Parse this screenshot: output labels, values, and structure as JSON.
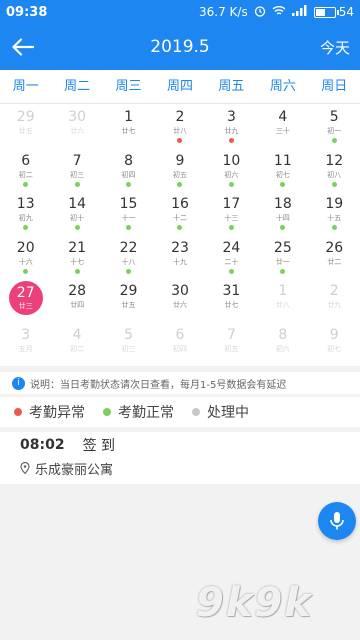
{
  "status_bar": {
    "time": "09:38",
    "speed": "36.7 K/s",
    "battery": "54",
    "battery_level": 0.54,
    "icons": [
      "alarm-icon",
      "wifi-icon",
      "signal-icon",
      "battery-icon"
    ]
  },
  "header": {
    "title": "2019.5",
    "today_label": "今天",
    "back_icon": "back-arrow-icon"
  },
  "weekdays": [
    "周一",
    "周二",
    "周三",
    "周四",
    "周五",
    "周六",
    "周日"
  ],
  "calendar": {
    "weeks": [
      [
        {
          "day": "29",
          "lunar": "廿五",
          "other": true,
          "dot": null
        },
        {
          "day": "30",
          "lunar": "廿六",
          "other": true,
          "dot": null
        },
        {
          "day": "1",
          "lunar": "廿七",
          "other": false,
          "dot": null
        },
        {
          "day": "2",
          "lunar": "廿八",
          "other": false,
          "dot": "red"
        },
        {
          "day": "3",
          "lunar": "廿九",
          "other": false,
          "dot": "red"
        },
        {
          "day": "4",
          "lunar": "三十",
          "other": false,
          "dot": null
        },
        {
          "day": "5",
          "lunar": "初一",
          "other": false,
          "dot": "green"
        }
      ],
      [
        {
          "day": "6",
          "lunar": "初二",
          "other": false,
          "dot": "green"
        },
        {
          "day": "7",
          "lunar": "初三",
          "other": false,
          "dot": "green"
        },
        {
          "day": "8",
          "lunar": "初四",
          "other": false,
          "dot": "green"
        },
        {
          "day": "9",
          "lunar": "初五",
          "other": false,
          "dot": "green"
        },
        {
          "day": "10",
          "lunar": "初六",
          "other": false,
          "dot": "green"
        },
        {
          "day": "11",
          "lunar": "初七",
          "other": false,
          "dot": "green"
        },
        {
          "day": "12",
          "lunar": "初八",
          "other": false,
          "dot": "green"
        }
      ],
      [
        {
          "day": "13",
          "lunar": "初九",
          "other": false,
          "dot": "green"
        },
        {
          "day": "14",
          "lunar": "初十",
          "other": false,
          "dot": "green"
        },
        {
          "day": "15",
          "lunar": "十一",
          "other": false,
          "dot": "green"
        },
        {
          "day": "16",
          "lunar": "十二",
          "other": false,
          "dot": "green"
        },
        {
          "day": "17",
          "lunar": "十三",
          "other": false,
          "dot": "green"
        },
        {
          "day": "18",
          "lunar": "十四",
          "other": false,
          "dot": "green"
        },
        {
          "day": "19",
          "lunar": "十五",
          "other": false,
          "dot": "green"
        }
      ],
      [
        {
          "day": "20",
          "lunar": "十六",
          "other": false,
          "dot": "green"
        },
        {
          "day": "21",
          "lunar": "十七",
          "other": false,
          "dot": "green"
        },
        {
          "day": "22",
          "lunar": "十八",
          "other": false,
          "dot": "green"
        },
        {
          "day": "23",
          "lunar": "十九",
          "other": false,
          "dot": null
        },
        {
          "day": "24",
          "lunar": "二十",
          "other": false,
          "dot": "green"
        },
        {
          "day": "25",
          "lunar": "廿一",
          "other": false,
          "dot": "green"
        },
        {
          "day": "26",
          "lunar": "廿二",
          "other": false,
          "dot": null
        }
      ],
      [
        {
          "day": "27",
          "lunar": "廿三",
          "other": false,
          "dot": null,
          "selected": true
        },
        {
          "day": "28",
          "lunar": "廿四",
          "other": false,
          "dot": null
        },
        {
          "day": "29",
          "lunar": "廿五",
          "other": false,
          "dot": null
        },
        {
          "day": "30",
          "lunar": "廿六",
          "other": false,
          "dot": null
        },
        {
          "day": "31",
          "lunar": "廿七",
          "other": false,
          "dot": null
        },
        {
          "day": "1",
          "lunar": "廿八",
          "other": true,
          "dot": null
        },
        {
          "day": "2",
          "lunar": "廿九",
          "other": true,
          "dot": null
        }
      ],
      [
        {
          "day": "3",
          "lunar": "五月",
          "other": true,
          "dot": null
        },
        {
          "day": "4",
          "lunar": "初二",
          "other": true,
          "dot": null
        },
        {
          "day": "5",
          "lunar": "初三",
          "other": true,
          "dot": null
        },
        {
          "day": "6",
          "lunar": "初四",
          "other": true,
          "dot": null
        },
        {
          "day": "7",
          "lunar": "初五",
          "other": true,
          "dot": null
        },
        {
          "day": "8",
          "lunar": "初六",
          "other": true,
          "dot": null
        },
        {
          "day": "9",
          "lunar": "初七",
          "other": true,
          "dot": null
        }
      ]
    ]
  },
  "notice": {
    "text": "说明：当日考勤状态请次日查看，每月1-5号数据会有延迟"
  },
  "legend": [
    {
      "label": "考勤异常",
      "color": "#f0584a"
    },
    {
      "label": "考勤正常",
      "color": "#7ccf5a"
    },
    {
      "label": "处理中",
      "color": "#c8c8c8"
    }
  ],
  "record": {
    "time": "08:02",
    "type": "签 到",
    "location": "乐成豪丽公寓"
  },
  "colors": {
    "primary": "#1d86f0",
    "selected": "#ec407a",
    "dot_red": "#f0584a",
    "dot_green": "#7ccf5a"
  },
  "watermark": "9k9k"
}
